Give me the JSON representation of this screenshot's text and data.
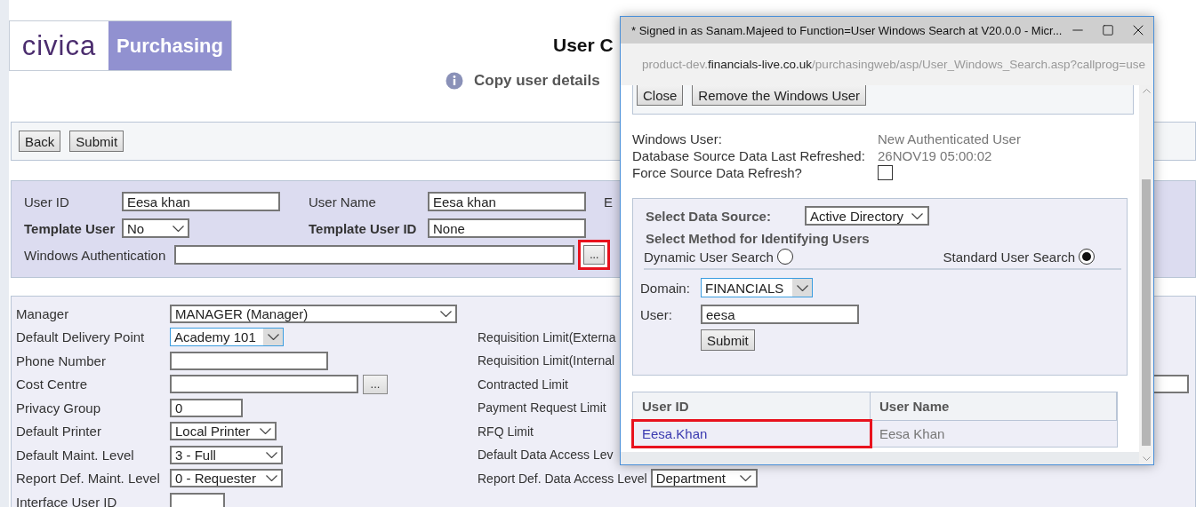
{
  "page": {
    "logo": {
      "wordmark": "civica",
      "product": "Purchasing"
    },
    "title": "User C",
    "info": "Copy user details",
    "toolbar": [
      "Back",
      "Submit"
    ],
    "user_panel": {
      "user_id": {
        "label": "User ID",
        "value": "Eesa khan"
      },
      "user_name": {
        "label": "User Name",
        "value": "Eesa khan"
      },
      "cut_label": "E",
      "template_user": {
        "label": "Template User",
        "value": "No"
      },
      "template_user_id": {
        "label": "Template User ID",
        "value": "None"
      },
      "windows_auth": {
        "label": "Windows Authentication",
        "lookup": {
          "text": "...",
          "highlighted": true
        }
      }
    },
    "form_rows": [
      {
        "left": {
          "label": "Manager",
          "kind": "select",
          "value": "MANAGER (Manager)",
          "focused": false
        }
      },
      {
        "left": {
          "label": "Default Delivery Point",
          "kind": "select",
          "value": "Academy 101",
          "focused": true
        },
        "right": {
          "label": "Requisition Limit(Externa"
        }
      },
      {
        "left": {
          "label": "Phone Number",
          "kind": "input"
        },
        "right": {
          "label": "Requisition Limit(Internal"
        }
      },
      {
        "left": {
          "label": "Cost Centre",
          "kind": "lookup",
          "button": "..."
        },
        "right": {
          "label": "Contracted Limit",
          "kind": "input"
        }
      },
      {
        "left": {
          "label": "Privacy Group",
          "kind": "input",
          "value": "0"
        },
        "right": {
          "label": "Payment Request Limit"
        }
      },
      {
        "left": {
          "label": "Default Printer",
          "kind": "select",
          "value": "Local Printer",
          "focused": false
        },
        "right": {
          "label": "RFQ Limit"
        }
      },
      {
        "left": {
          "label": "Default Maint. Level",
          "kind": "select",
          "value": "3 - Full",
          "focused": false
        },
        "right": {
          "label": "Default Data Access Lev"
        }
      },
      {
        "left": {
          "label": "Report Def. Maint. Level",
          "kind": "select",
          "value": "0 - Requester",
          "focused": false
        },
        "right": {
          "label": "Report Def. Data Access Level",
          "kind": "select",
          "value": "Department"
        }
      },
      {
        "left": {
          "label": "Interface User ID",
          "kind": "input"
        }
      }
    ]
  },
  "popup": {
    "title": "* Signed in as Sanam.Majeed to Function=User Windows Search at V20.0.0 - Micr...",
    "url": {
      "prefix": "product-dev.",
      "host": "financials-live.co.uk",
      "path": "/purchasingweb/asp/User_Windows_Search.asp?callprog=use"
    },
    "buttons": [
      "Close",
      "Remove the Windows User"
    ],
    "details": [
      {
        "label": "Windows User:",
        "value": "New Authenticated User"
      },
      {
        "label": "Database Source Data Last Refreshed:",
        "value": "26NOV19 05:00:02"
      }
    ],
    "force_refresh": {
      "label": "Force Source Data Refresh?",
      "checked": false
    },
    "search": {
      "data_source": {
        "label": "Select Data Source:",
        "value": "Active Directory"
      },
      "method_heading": "Select Method for Identifying Users",
      "methods": [
        {
          "label": "Dynamic User Search",
          "selected": false
        },
        {
          "label": "Standard User Search",
          "selected": true
        }
      ],
      "domain": {
        "label": "Domain:",
        "value": "FINANCIALS",
        "focused": true
      },
      "user": {
        "label": "User:",
        "value": "eesa"
      },
      "submit": "Submit"
    },
    "results": {
      "columns": [
        "User ID",
        "User Name"
      ],
      "rows": [
        {
          "user_id": "Eesa.Khan",
          "user_name": "Eesa Khan",
          "highlighted": true
        }
      ]
    }
  }
}
